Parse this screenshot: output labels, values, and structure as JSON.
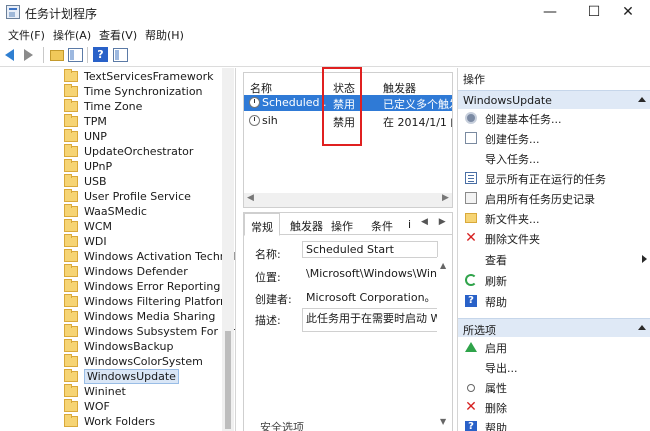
{
  "window": {
    "title": "任务计划程序",
    "minimize": "—",
    "maximize": "☐",
    "close": "✕"
  },
  "menu": [
    "文件(F)",
    "操作(A)",
    "查看(V)",
    "帮助(H)"
  ],
  "tree": {
    "items": [
      "TextServicesFramework",
      "Time Synchronization",
      "Time Zone",
      "TPM",
      "UNP",
      "UpdateOrchestrator",
      "UPnP",
      "USB",
      "User Profile Service",
      "WaaSMedic",
      "WCM",
      "WDI",
      "Windows Activation Technolo",
      "Windows Defender",
      "Windows Error Reporting",
      "Windows Filtering Platform",
      "Windows Media Sharing",
      "Windows Subsystem For Linux",
      "WindowsBackup",
      "WindowsColorSystem",
      "WindowsUpdate",
      "Wininet",
      "WOF",
      "Work Folders"
    ],
    "selected": "WindowsUpdate"
  },
  "tasklist": {
    "columns": [
      "名称",
      "状态",
      "触发器"
    ],
    "rows": [
      {
        "name": "Scheduled ...",
        "status": "禁用",
        "trigger": "已定义多个触发",
        "selected": true
      },
      {
        "name": "sih",
        "status": "禁用",
        "trigger": "在 2014/1/1 的",
        "selected": false
      }
    ],
    "scroll_left": "◀",
    "scroll_right": "▶"
  },
  "detail": {
    "tabs": [
      "常规",
      "触发器",
      "操作",
      "条件",
      "i"
    ],
    "tab_arrows": "◀ ▶",
    "fields": [
      {
        "label": "名称:",
        "value": "Scheduled Start"
      },
      {
        "label": "位置:",
        "value": "\\Microsoft\\Windows\\Window"
      },
      {
        "label": "创建者:",
        "value": "Microsoft Corporation。"
      },
      {
        "label": "描述:",
        "value": "此任务用于在需要时启动 Wi"
      }
    ],
    "scroll_up": "▲",
    "scroll_down": "▼",
    "bottom_text": "安全选项"
  },
  "actions": {
    "header": "操作",
    "section1": {
      "title": "WindowsUpdate",
      "items": [
        {
          "label": "创建基本任务...",
          "icon": "gear-icon"
        },
        {
          "label": "创建任务...",
          "icon": "create-task-icon"
        },
        {
          "label": "导入任务...",
          "icon": "import-icon"
        },
        {
          "label": "显示所有正在运行的任务",
          "icon": "list-icon"
        },
        {
          "label": "启用所有任务历史记录",
          "icon": "history-icon"
        },
        {
          "label": "新文件夹...",
          "icon": "folder-icon"
        },
        {
          "label": "删除文件夹",
          "icon": "delete-icon"
        },
        {
          "label": "查看",
          "icon": "none",
          "submenu": true
        },
        {
          "label": "刷新",
          "icon": "refresh-icon"
        },
        {
          "label": "帮助",
          "icon": "help-icon"
        }
      ]
    },
    "section2": {
      "title": "所选项",
      "items": [
        {
          "label": "启用",
          "icon": "enable-icon"
        },
        {
          "label": "导出...",
          "icon": "none"
        },
        {
          "label": "属性",
          "icon": "properties-icon"
        },
        {
          "label": "删除",
          "icon": "delete-icon"
        },
        {
          "label": "帮助",
          "icon": "help-icon"
        }
      ]
    }
  }
}
